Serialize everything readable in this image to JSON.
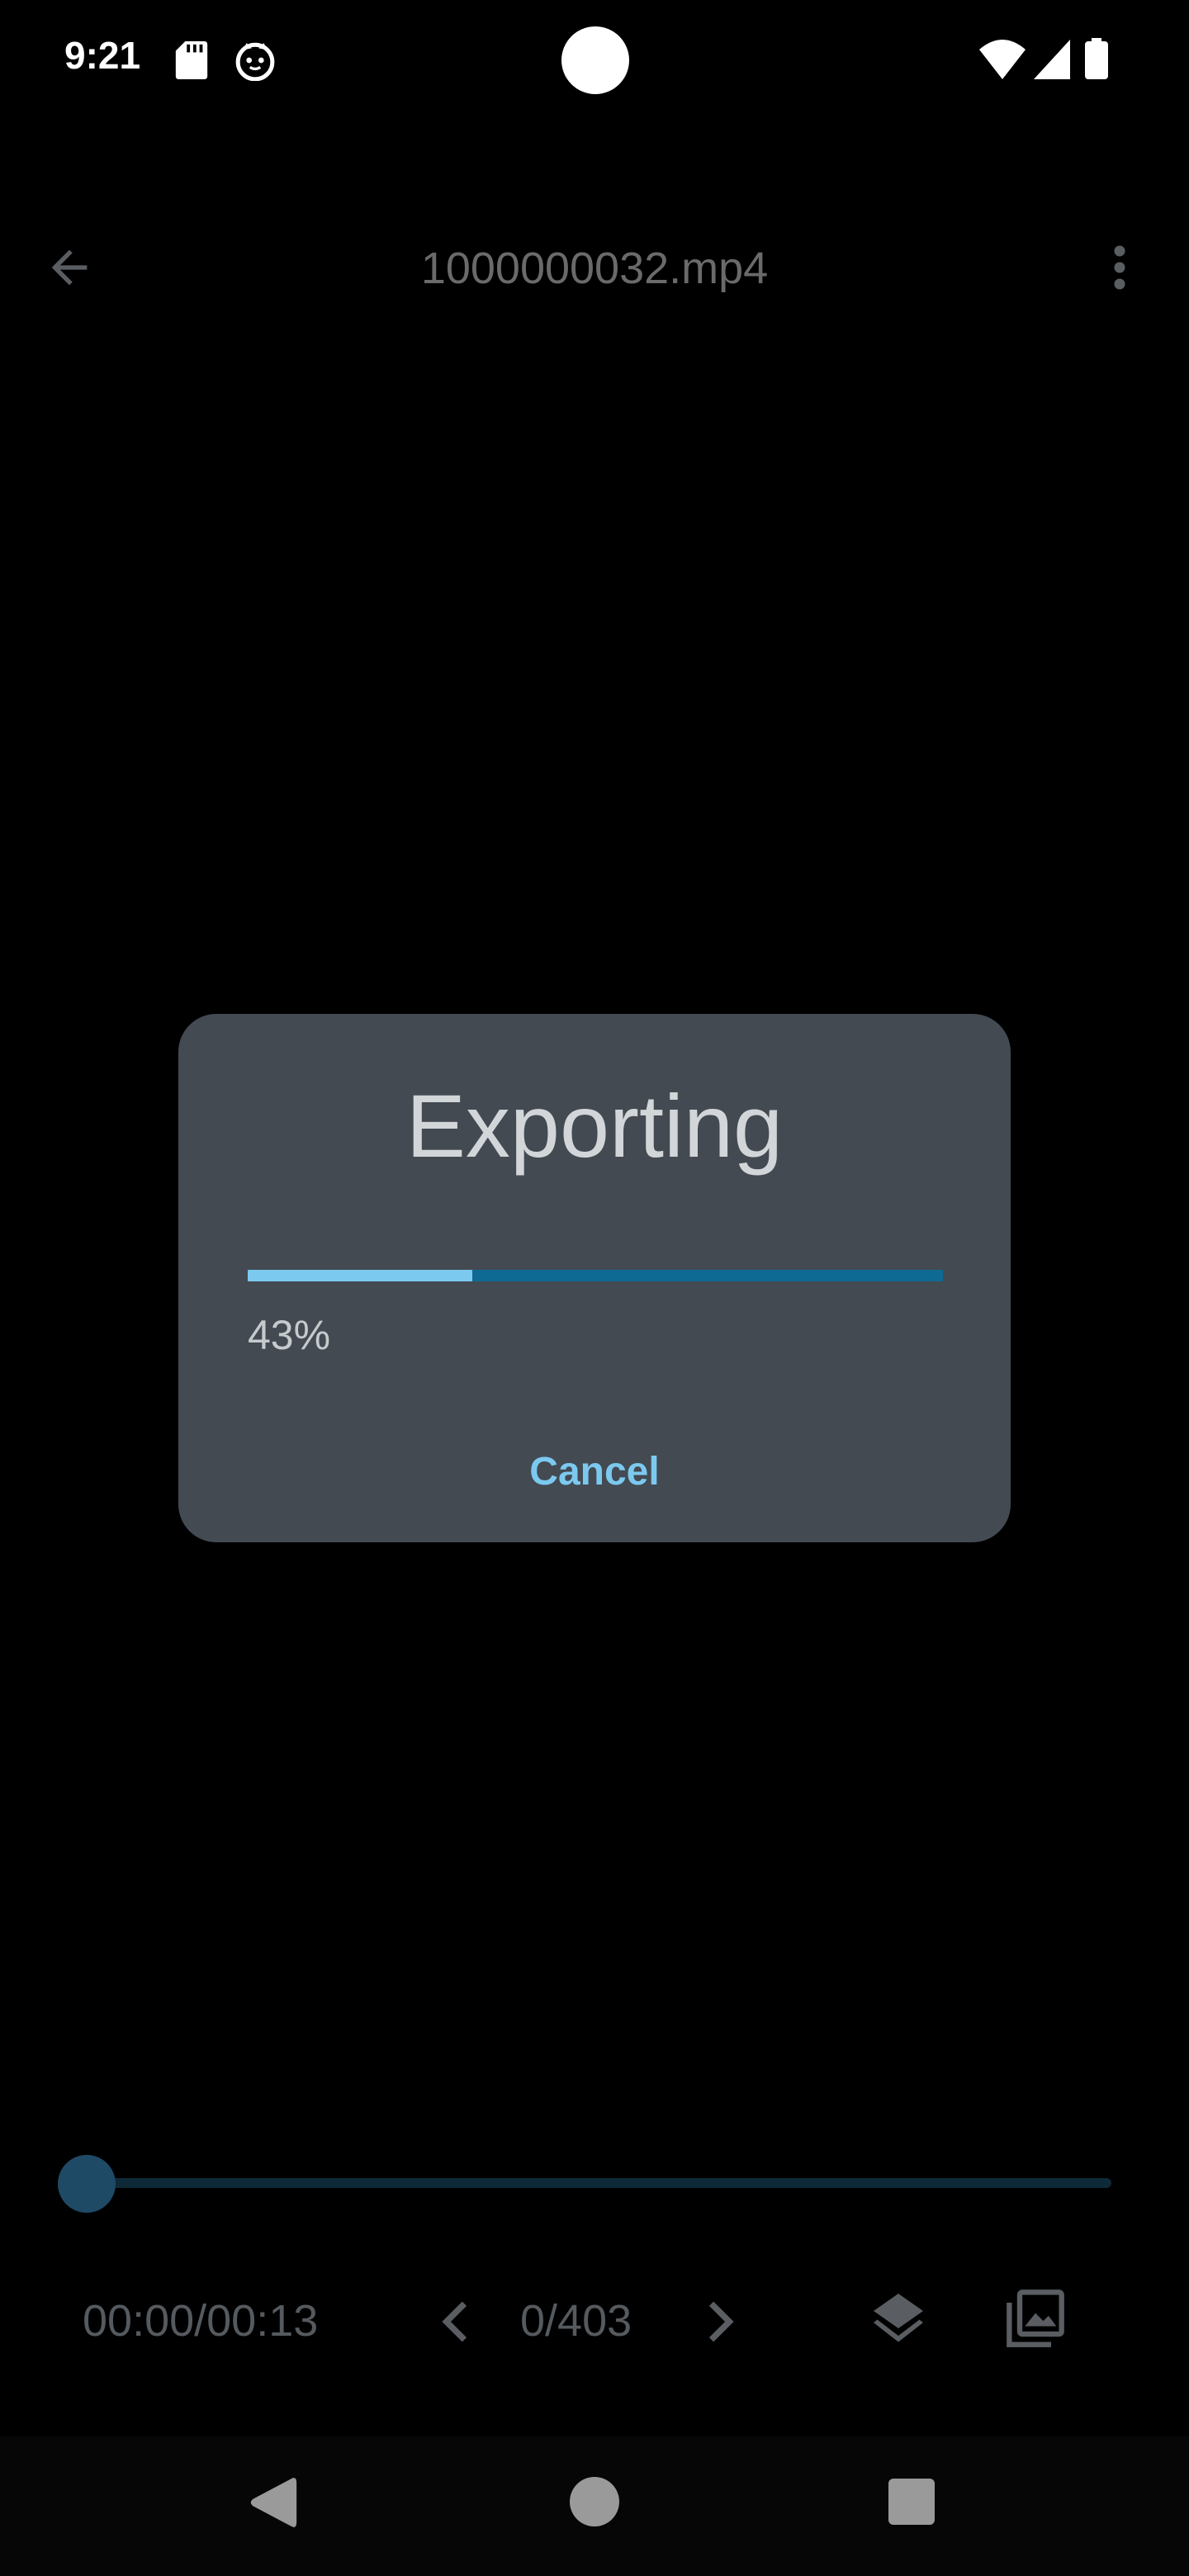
{
  "status_bar": {
    "time": "9:21",
    "icons": [
      "sd-card-icon",
      "cat-icon",
      "wifi-icon",
      "signal-icon",
      "battery-icon"
    ]
  },
  "toolbar": {
    "back_icon": "arrow-left-icon",
    "title": "1000000032.mp4",
    "more_icon": "more-vert-icon"
  },
  "dialog": {
    "title": "Exporting",
    "progress_percent": 43,
    "progress_label": "43%",
    "cancel_label": "Cancel"
  },
  "player": {
    "seek_position": 0,
    "time": "00:00/00:13",
    "frame": "0/403",
    "prev_icon": "chevron-left-icon",
    "next_icon": "chevron-right-icon",
    "layers_icon": "layers-icon",
    "gallery_icon": "photo-library-icon"
  },
  "navigation": {
    "icons": [
      "nav-back-icon",
      "nav-home-icon",
      "nav-recents-icon"
    ]
  },
  "colors": {
    "background": "#000000",
    "dialog_bg": "#434a52",
    "accent": "#7cc9f0",
    "progress_track": "#0f6a93",
    "muted_text": "#555a5f"
  }
}
